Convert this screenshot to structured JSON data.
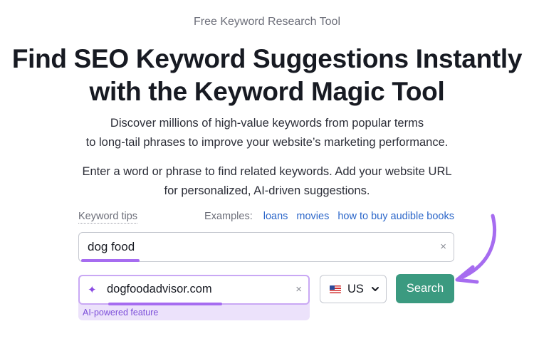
{
  "header": {
    "eyebrow": "Free Keyword Research Tool",
    "title_line1": "Find SEO Keyword Suggestions Instantly",
    "title_line2": "with the Keyword Magic Tool"
  },
  "intro": {
    "line1": "Discover millions of high-value keywords from popular terms",
    "line2": "to long-tail phrases to improve your website’s marketing performance."
  },
  "instructions": {
    "line1": "Enter a word or phrase to find related keywords. Add your website URL",
    "line2": "for personalized, AI-driven suggestions."
  },
  "form": {
    "tips_label": "Keyword tips",
    "examples_label": "Examples:",
    "examples": [
      "loans",
      "movies",
      "how to buy audible books"
    ],
    "keyword_value": "dog food",
    "url_value": "dogfoodadvisor.com",
    "ai_label": "AI-powered feature",
    "country": "US",
    "search_label": "Search",
    "clear_glyph": "×",
    "sparkle_glyph": "✦"
  },
  "colors": {
    "accent_purple": "#a66cf0",
    "search_green": "#3b9a80",
    "link_blue": "#2b66c9"
  },
  "icons": [
    "sparkle-icon",
    "clear-icon",
    "us-flag-icon",
    "chevron-down-icon",
    "curved-arrow-icon"
  ]
}
